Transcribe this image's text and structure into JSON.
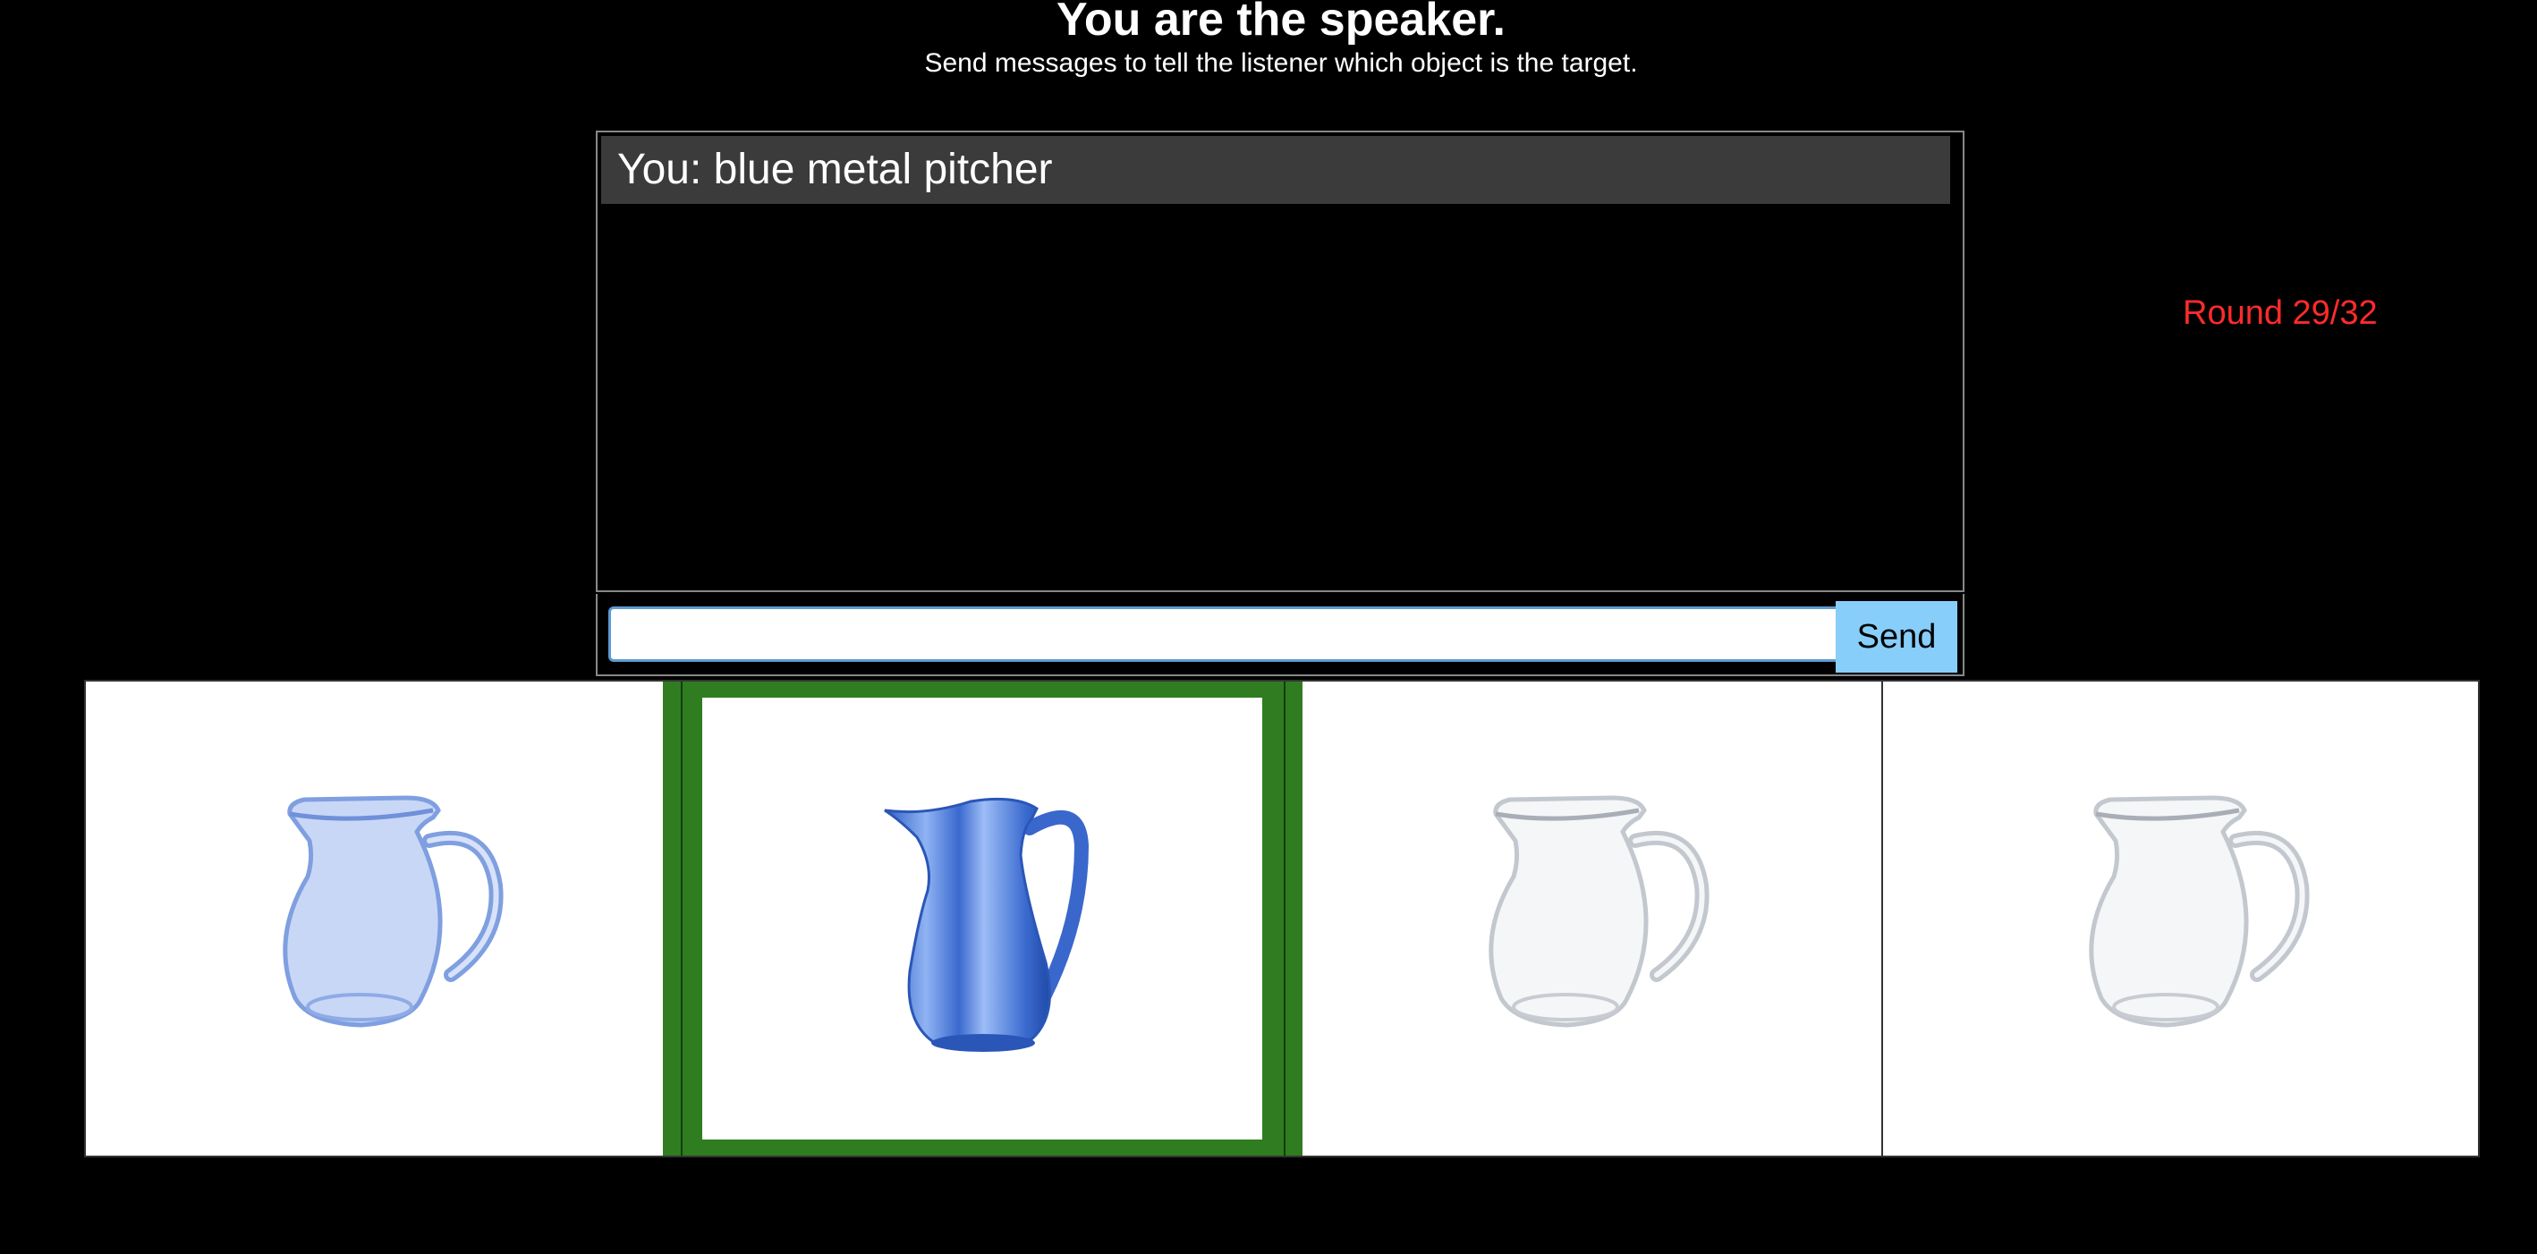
{
  "header": {
    "title": "You are the speaker.",
    "subtitle": "Send messages to tell the listener which object is the target."
  },
  "chat": {
    "messages": [
      {
        "text": "You: blue metal pitcher"
      }
    ],
    "input_value": "",
    "input_placeholder": "",
    "send_label": "Send"
  },
  "status": {
    "round_text": "Round 29/32",
    "round_color": "#ff2b2b"
  },
  "objects": [
    {
      "icon": "glass-pitcher-icon",
      "color": "#9fb8ee",
      "target": false
    },
    {
      "icon": "metal-pitcher-icon",
      "color": "#4f7fd8",
      "target": true
    },
    {
      "icon": "glass-pitcher-icon",
      "color": "#d8dde3",
      "target": false
    },
    {
      "icon": "glass-pitcher-icon",
      "color": "#d8dde3",
      "target": false
    }
  ],
  "colors": {
    "background": "#000000",
    "target_border": "#2f7d20",
    "send_button": "#87cefa",
    "message_bg": "#3b3b3b"
  }
}
